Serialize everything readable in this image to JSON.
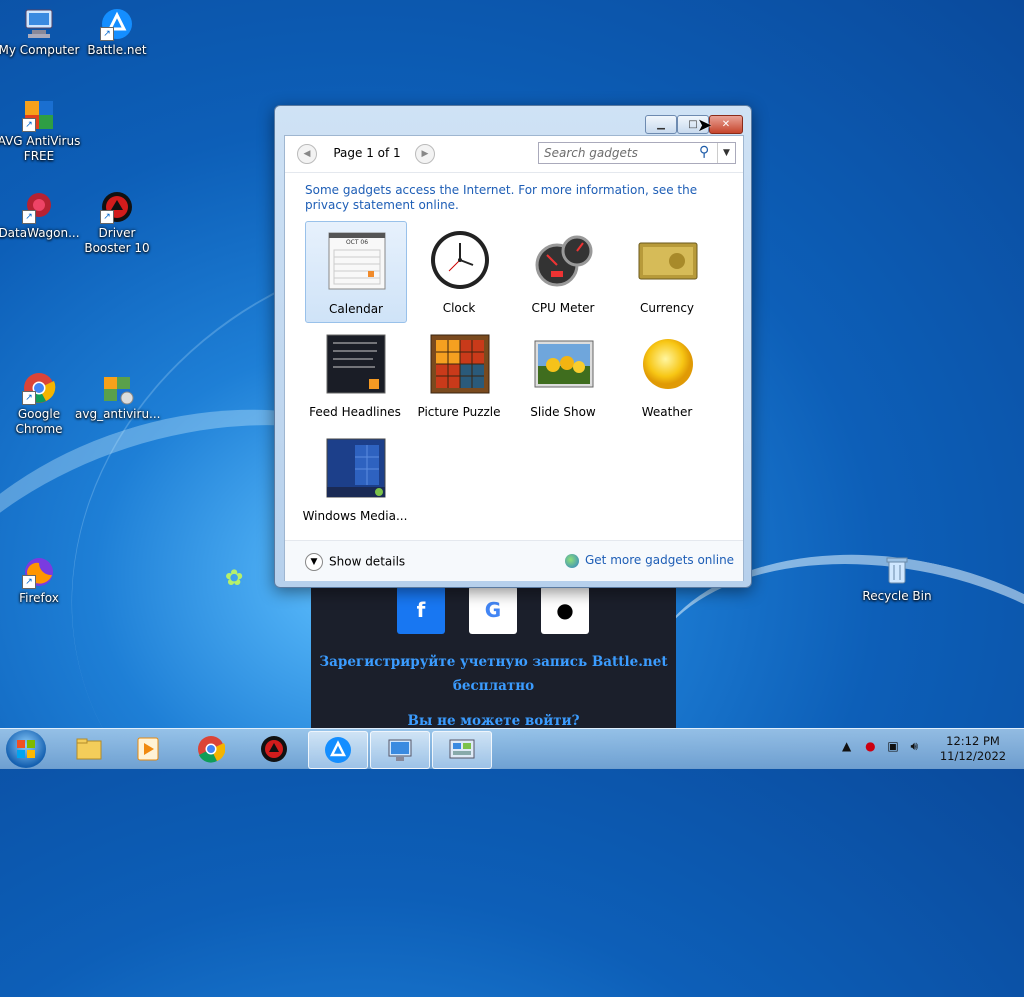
{
  "desktop": {
    "icons": [
      {
        "label": "My Computer"
      },
      {
        "label": "Battle.net"
      },
      {
        "label": "AVG AntiVirus FREE"
      },
      {
        "label": "DataWagon..."
      },
      {
        "label": "Driver Booster 10"
      },
      {
        "label": "Google Chrome"
      },
      {
        "label": "avg_antiviru..."
      },
      {
        "label": "Firefox"
      },
      {
        "label": "Recycle Bin"
      }
    ]
  },
  "battlenet_page": {
    "signup_line1": "Зарегистрируйте учетную запись Battle.net",
    "signup_line2": "бесплатно",
    "cant_login": "Вы не можете войти?"
  },
  "gadget_window": {
    "pager_text": "Page 1 of 1",
    "search_placeholder": "Search gadgets",
    "notice": "Some gadgets access the Internet.  For more information, see the privacy statement online.",
    "calendar_month": "OCT 06",
    "gadgets": [
      {
        "label": "Calendar",
        "selected": true
      },
      {
        "label": "Clock"
      },
      {
        "label": "CPU Meter"
      },
      {
        "label": "Currency"
      },
      {
        "label": "Feed Headlines"
      },
      {
        "label": "Picture Puzzle"
      },
      {
        "label": "Slide Show"
      },
      {
        "label": "Weather"
      },
      {
        "label": "Windows Media..."
      }
    ],
    "show_details": "Show details",
    "get_more": "Get more gadgets online"
  },
  "taskbar": {
    "time": "12:12 PM",
    "date": "11/12/2022"
  },
  "colors": {
    "link": "#1e5eb6",
    "accent": "#1877f2"
  }
}
